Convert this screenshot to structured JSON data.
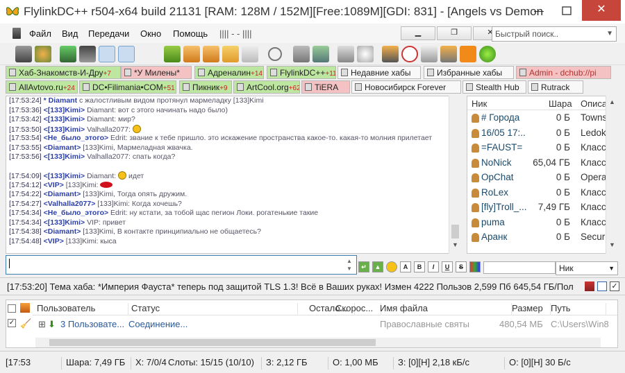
{
  "window": {
    "title": "FlylinkDC++ r504-x64 build 21131 [RAM: 128M / 152M][Free:1089M][GDI: 831] - [Angels vs Demon",
    "close_glyph": "✕",
    "min_glyph": "—"
  },
  "menu": {
    "items": [
      "Файл",
      "Вид",
      "Передачи",
      "Окно",
      "Помощь",
      "||||  -  -  ||||"
    ],
    "quick_search_placeholder": "Быстрый поиск.."
  },
  "hub_tabs_row1": [
    {
      "label": "Хаб-Знакомств-И-Дру",
      "badge": "+7"
    },
    {
      "label": "*У Милены*",
      "badge": ""
    },
    {
      "label": "Адреналин",
      "badge": "+14"
    },
    {
      "label": "FlylinkDC++",
      "badge": "+11"
    },
    {
      "label": "Недавние хабы",
      "badge": ""
    },
    {
      "label": "Избранные хабы",
      "badge": ""
    },
    {
      "label": "Admin - dchub://pi",
      "badge": ""
    }
  ],
  "hub_tabs_row2": [
    {
      "label": "AllAvtovo.ru",
      "badge": "+24"
    },
    {
      "label": "DC•Filimania•COM",
      "badge": "+51"
    },
    {
      "label": "Пикник",
      "badge": "+9"
    },
    {
      "label": "ArtCool.org",
      "badge": "+62"
    },
    {
      "label": "TiERA",
      "badge": ""
    },
    {
      "label": "Новосибирск Forever",
      "badge": ""
    },
    {
      "label": "Stealth Hub",
      "badge": ""
    },
    {
      "label": "Rutrack",
      "badge": ""
    }
  ],
  "chat": [
    {
      "ts": "[17:53:24]",
      "nick": "* Diamant",
      "text": " с жалостливым видом протянул мармеладку [133]Kimi"
    },
    {
      "ts": "[17:53:36]",
      "nick": "<[133]Kimi>",
      "text": " Diamant: вот с этого начинать надо было)"
    },
    {
      "ts": "[17:53:42]",
      "nick": "<[133]Kimi>",
      "text": " Diamant: мир?"
    },
    {
      "ts": "[17:53:50]",
      "nick": "<[133]Kimi>",
      "text": " Valhalla2077: ",
      "emo": "smile"
    },
    {
      "ts": "[17:53:54]",
      "nick": "<Не_было_этого>",
      "text": " Edrit: звание к тебе пришло. это искажение пространства какое-то. какая-то молния прилетает"
    },
    {
      "ts": "[17:53:55]",
      "nick": "<Diamant>",
      "text": " [133]Kimi, Мармеладная жвачка."
    },
    {
      "ts": "[17:53:56]",
      "nick": "<[133]Kimi>",
      "text": " Valhalla2077: спать когда?"
    },
    {
      "ts": "",
      "nick": "",
      "text": ""
    },
    {
      "ts": "[17:54:09]",
      "nick": "<[133]Kimi>",
      "text": " Diamant: ",
      "emo": "smile",
      "after": " идет"
    },
    {
      "ts": "[17:54:12]",
      "nick": "<VIP>",
      "text": " [133]Kimi: ",
      "emo": "lips"
    },
    {
      "ts": "[17:54:22]",
      "nick": "<Diamant>",
      "text": " [133]Kimi, Тогда опять дружим."
    },
    {
      "ts": "[17:54:27]",
      "nick": "<Valhalla2077>",
      "text": " [133]Kimi: Когда хочешь?"
    },
    {
      "ts": "[17:54:34]",
      "nick": "<Не_было_этого>",
      "text": " Edrit: ну кстати, за тобой щас пегион Локи. рогатенькие такие"
    },
    {
      "ts": "[17:54:34]",
      "nick": "<[133]Kimi>",
      "text": " VIP: привет"
    },
    {
      "ts": "[17:54:38]",
      "nick": "<Diamant>",
      "text": " [133]Kimi, В контакте принципиально не общаетесь?"
    },
    {
      "ts": "[17:54:48]",
      "nick": "<VIP>",
      "text": " [133]Kimi: кыса"
    }
  ],
  "userlist": {
    "headers": [
      "Ник",
      "Шара",
      "Описа"
    ],
    "rows": [
      {
        "nick": "# Города",
        "share": "0 Б",
        "desc": "Towns"
      },
      {
        "nick": "16/05 17:..",
        "share": "0 Б",
        "desc": "Ledok"
      },
      {
        "nick": "=FAUST=",
        "share": "0 Б",
        "desc": "Класс"
      },
      {
        "nick": "NoNick",
        "share": "65,04 ГБ",
        "desc": "Класс"
      },
      {
        "nick": "OpChat",
        "share": "0 Б",
        "desc": "Opera"
      },
      {
        "nick": "RoLex",
        "share": "0 Б",
        "desc": "Класс"
      },
      {
        "nick": "[fly]Troll_...",
        "share": "7,49 ГБ",
        "desc": "Класс"
      },
      {
        "nick": "puma",
        "share": "0 Б",
        "desc": "Класс"
      },
      {
        "nick": "Аранк",
        "share": "0 Б",
        "desc": "Securi"
      }
    ]
  },
  "nick_select": "Ник",
  "status_line": "[17:53:20] Тема хаба: *Империя Фауста* теперь под защитой TLS 1.3! Всё в Ваших руках! Измен 4222 Пользов 2,599 Пб  645,54 ГБ/Пол",
  "transfers": {
    "headers": [
      "Пользователь",
      "Статус",
      "Остало...",
      "Скорос...",
      "Имя файла",
      "Размер",
      "Путь"
    ],
    "row": {
      "user": "3 Пользовате...",
      "status": "Соединение...",
      "file": "Православные святы",
      "size": "480,54 МБ",
      "path": "C:\\Users\\Win8"
    }
  },
  "statusbar": [
    "[17:53",
    "Шара: 7,49 ГБ",
    "Х: 7/0/4",
    "Слоты: 15/15 (10/10)",
    "З: 2,12 ГБ",
    "О: 1,00 МБ",
    "З: [0][H] 2,18 кБ/с",
    "О: [0][H] 30 Б/с"
  ]
}
